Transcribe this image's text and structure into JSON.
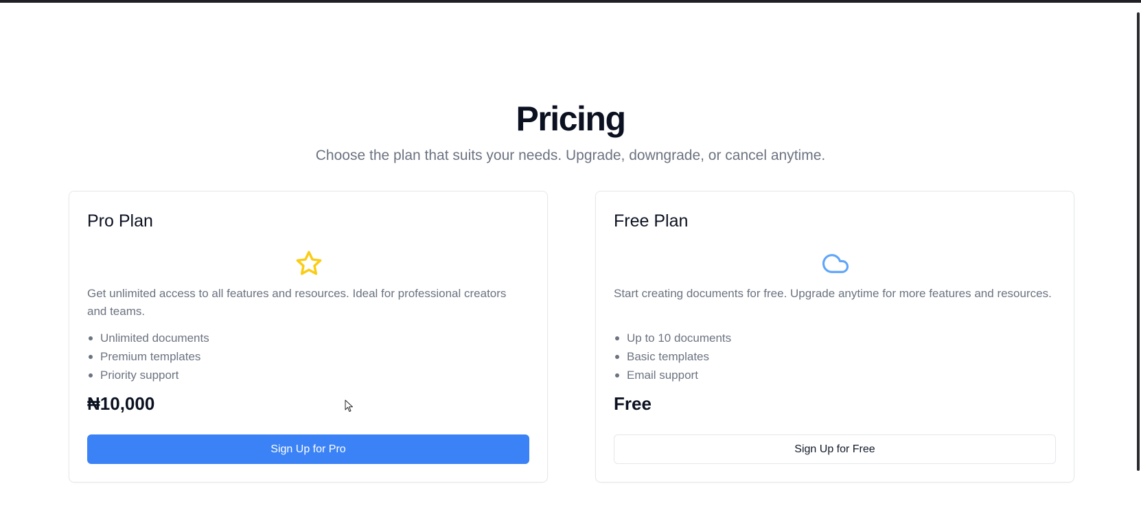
{
  "header": {
    "title": "Pricing",
    "subtitle": "Choose the plan that suits your needs. Upgrade, downgrade, or cancel anytime."
  },
  "plans": [
    {
      "name": "Pro Plan",
      "icon": "star-icon",
      "icon_color": "#facc15",
      "description": "Get unlimited access to all features and resources. Ideal for professional creators and teams.",
      "features": [
        "Unlimited documents",
        "Premium templates",
        "Priority support"
      ],
      "price": "₦10,000",
      "button_label": "Sign Up for Pro",
      "button_color": "#3b82f6"
    },
    {
      "name": "Free Plan",
      "icon": "cloud-icon",
      "icon_color": "#60a5fa",
      "description": "Start creating documents for free. Upgrade anytime for more features and resources.",
      "features": [
        "Up to 10 documents",
        "Basic templates",
        "Email support"
      ],
      "price": "Free",
      "button_label": "Sign Up for Free"
    }
  ]
}
